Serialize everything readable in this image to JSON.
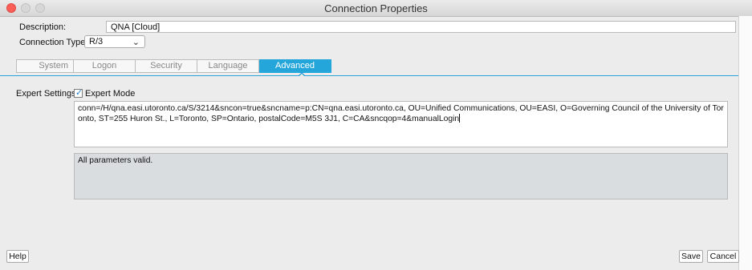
{
  "window": {
    "title": "Connection Properties"
  },
  "form": {
    "description_label": "Description:",
    "description_value": "QNA [Cloud]",
    "connection_type_label": "Connection Type:",
    "connection_type_value": "R/3",
    "chevron": "⌄"
  },
  "tabs": [
    {
      "label": "System",
      "active": false
    },
    {
      "label": "Logon",
      "active": false
    },
    {
      "label": "Security",
      "active": false
    },
    {
      "label": "Language",
      "active": false
    },
    {
      "label": "Advanced",
      "active": true
    }
  ],
  "advanced": {
    "expert_settings_label": "Expert Settings:",
    "expert_mode_label": "Expert Mode",
    "expert_mode_checked": true,
    "connection_string": "conn=/H/qna.easi.utoronto.ca/S/3214&sncon=true&sncname=p:CN=qna.easi.utoronto.ca, OU=Unified Communications, OU=EASI, O=Governing Council of the University of Toronto, ST=255 Huron St., L=Toronto, SP=Ontario, postalCode=M5S 3J1, C=CA&sncqop=4&manualLogin",
    "validation_message": "All parameters valid."
  },
  "buttons": {
    "help": "Help",
    "save": "Save",
    "cancel": "Cancel"
  },
  "icons": {
    "checkmark": "✓"
  },
  "colors": {
    "accent": "#25a6db",
    "close": "#fc5f57"
  }
}
